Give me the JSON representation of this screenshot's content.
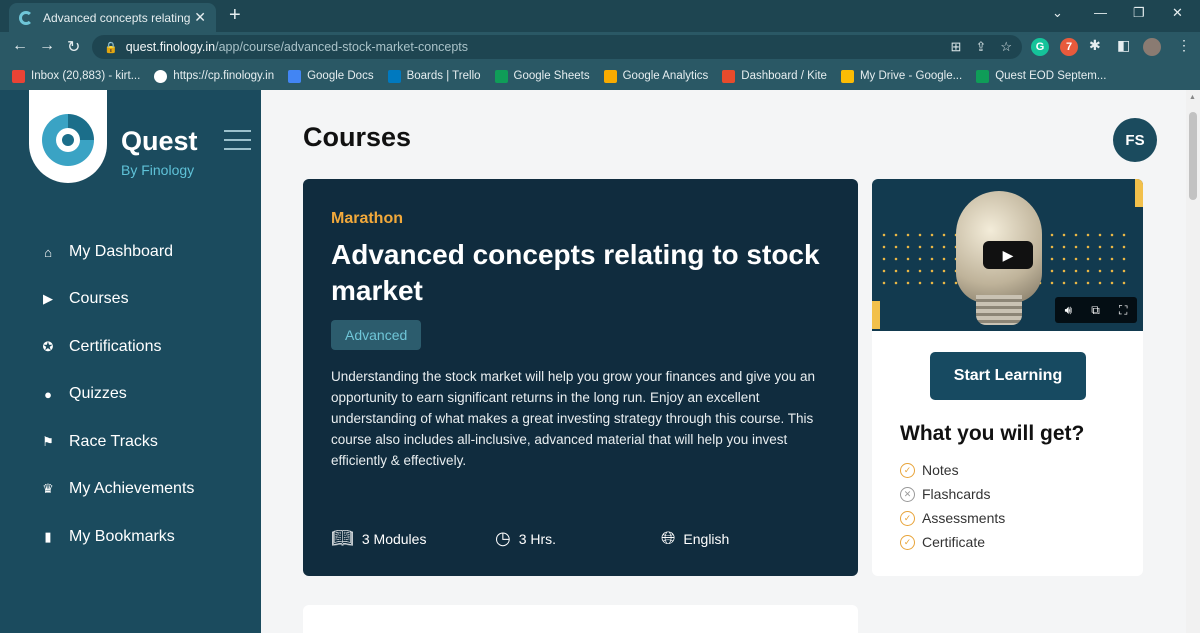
{
  "browser": {
    "tab_title": "Advanced concepts relating to st",
    "tab_close": "✕",
    "new_tab": "+",
    "window_controls": [
      "⌄",
      "—",
      "❐",
      "✕"
    ],
    "url_host": "quest.finology.in",
    "url_path": "/app/course/advanced-stock-market-concepts",
    "extensions": [
      {
        "icon": "grammarly-icon",
        "label": "G",
        "color": "#15c39a"
      },
      {
        "icon": "extension-red-icon",
        "label": "7",
        "color": "#e85a3c"
      }
    ],
    "bookmarks": [
      {
        "label": "Inbox (20,883) - kirt...",
        "color": "#ea4335"
      },
      {
        "label": "https://cp.finology.in",
        "color": "#ffffff"
      },
      {
        "label": "Google Docs",
        "color": "#4285f4"
      },
      {
        "label": "Boards | Trello",
        "color": "#0079bf"
      },
      {
        "label": "Google Sheets",
        "color": "#0f9d58"
      },
      {
        "label": "Google Analytics",
        "color": "#f9ab00"
      },
      {
        "label": "Dashboard / Kite",
        "color": "#e84b2c"
      },
      {
        "label": "My Drive - Google...",
        "color": "#fbbc04"
      },
      {
        "label": "Quest EOD Septem...",
        "color": "#0f9d58"
      }
    ]
  },
  "sidebar": {
    "brand": "Quest",
    "brand_sub": "By Finology",
    "items": [
      {
        "label": "My Dashboard",
        "icon": "⌂"
      },
      {
        "label": "Courses",
        "icon": "▶"
      },
      {
        "label": "Certifications",
        "icon": "✪"
      },
      {
        "label": "Quizzes",
        "icon": "●"
      },
      {
        "label": "Race Tracks",
        "icon": "⚑"
      },
      {
        "label": "My Achievements",
        "icon": "♛"
      },
      {
        "label": "My Bookmarks",
        "icon": "▮"
      }
    ]
  },
  "main": {
    "page_title": "Courses",
    "avatar": "FS",
    "course": {
      "tag": "Marathon",
      "title": "Advanced concepts relating to stock market",
      "level": "Advanced",
      "description": "Understanding the stock market will help you grow your finances and give you an opportunity to earn significant returns in the long run. Enjoy an excellent understanding of what makes a great investing strategy through this course. This course also includes all-inclusive, advanced material that will help you invest efficiently & effectively.",
      "modules": "3 Modules",
      "duration": "3 Hrs.",
      "language": "English"
    },
    "side": {
      "start_label": "Start Learning",
      "get_title": "What you will get?",
      "items": [
        {
          "label": "Notes",
          "included": true
        },
        {
          "label": "Flashcards",
          "included": false
        },
        {
          "label": "Assessments",
          "included": true
        },
        {
          "label": "Certificate",
          "included": true
        }
      ]
    }
  },
  "colors": {
    "sidebar": "#1b4b5e",
    "card": "#102c3e",
    "accent": "#f2a93b",
    "button": "#174a61"
  }
}
